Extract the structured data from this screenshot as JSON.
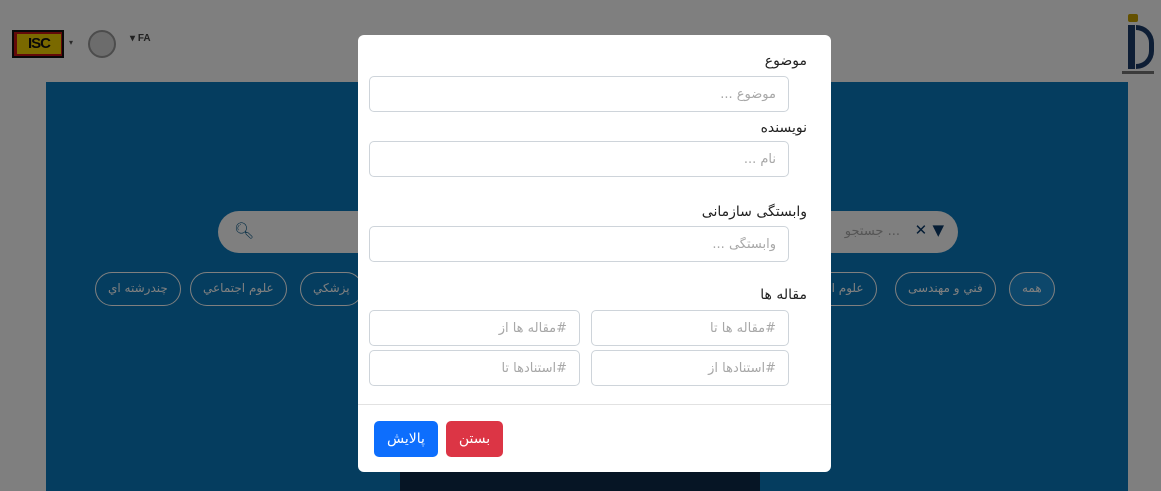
{
  "header": {
    "logo_text": "ISC",
    "language": "FA"
  },
  "search": {
    "placeholder": "جستجو ..."
  },
  "categories": [
    "همه",
    "فني و مهندسی",
    "علوم انس",
    "پزشکي",
    "علوم اجتماعي",
    "چندرشته اي"
  ],
  "modal": {
    "subject": {
      "label": "موضوع",
      "placeholder": "موضوع ..."
    },
    "author": {
      "label": "نويسنده",
      "placeholder": "نام ..."
    },
    "affiliation": {
      "label": "وابستگی سازمانی",
      "placeholder": "وابستگی ..."
    },
    "articles": {
      "label": "مقاله ها",
      "articles_to_placeholder": "#مقاله ها تا",
      "articles_from_placeholder": "#مقاله ها از",
      "professors_from_placeholder": "#استنادها از",
      "professors_to_placeholder": "#استنادها تا"
    },
    "filter_button": "پالایش",
    "close_button": "بستن"
  },
  "colors": {
    "hero_bg": "#0a7bbf",
    "primary": "#0d6efd",
    "danger": "#dc3545"
  }
}
